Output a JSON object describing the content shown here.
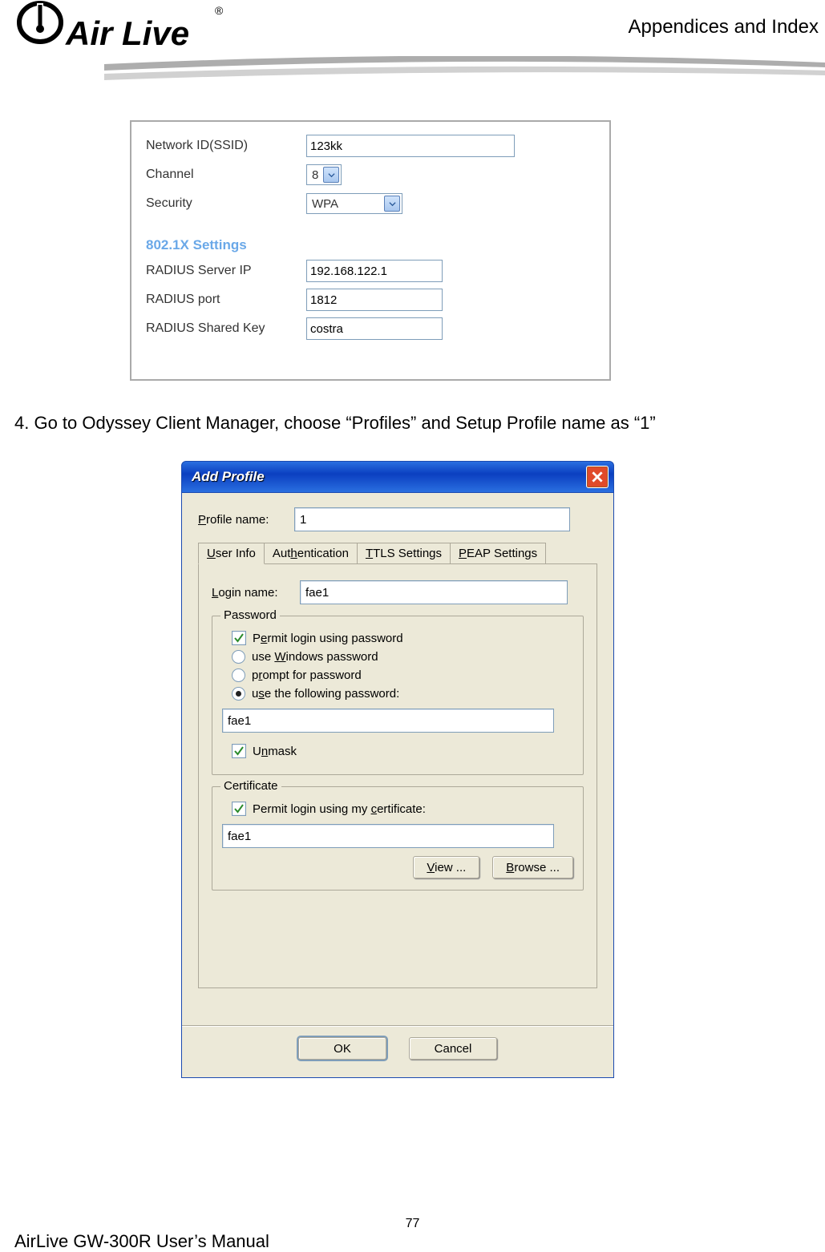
{
  "header": {
    "section_title": "Appendices and Index",
    "logo_text": "Air Live",
    "logo_tm": "®"
  },
  "router": {
    "ssid": {
      "label": "Network ID(SSID)",
      "value": "123kk"
    },
    "channel": {
      "label": "Channel",
      "value": "8"
    },
    "security": {
      "label": "Security",
      "value": "WPA"
    },
    "section": "802.1X Settings",
    "radius_ip": {
      "label": "RADIUS Server IP",
      "value": "192.168.122.1"
    },
    "radius_port": {
      "label": "RADIUS port",
      "value": "1812"
    },
    "radius_key": {
      "label": "RADIUS Shared Key",
      "value": "costra"
    }
  },
  "instruction": "4. Go to Odyssey Client Manager, choose “Profiles” and Setup Profile name as “1”",
  "dialog": {
    "title": "Add Profile",
    "profile_name": {
      "label": "Profile name:",
      "value": "1"
    },
    "tabs": {
      "user_info": "User Info",
      "authentication": "Authentication",
      "ttls": "TTLS Settings",
      "peap": "PEAP Settings"
    },
    "login": {
      "label": "Login name:",
      "value": "fae1"
    },
    "password_group": {
      "legend": "Password",
      "permit": "Permit login using password",
      "use_windows": "use Windows password",
      "prompt": "prompt for password",
      "use_following": "use the following password:",
      "value": "fae1",
      "unmask": "Unmask"
    },
    "certificate_group": {
      "legend": "Certificate",
      "permit": "Permit login using my certificate:",
      "value": "fae1",
      "view": "View ...",
      "browse": "Browse ..."
    },
    "buttons": {
      "ok": "OK",
      "cancel": "Cancel"
    }
  },
  "footer": {
    "manual": "AirLive GW-300R User’s Manual",
    "page": "77"
  }
}
